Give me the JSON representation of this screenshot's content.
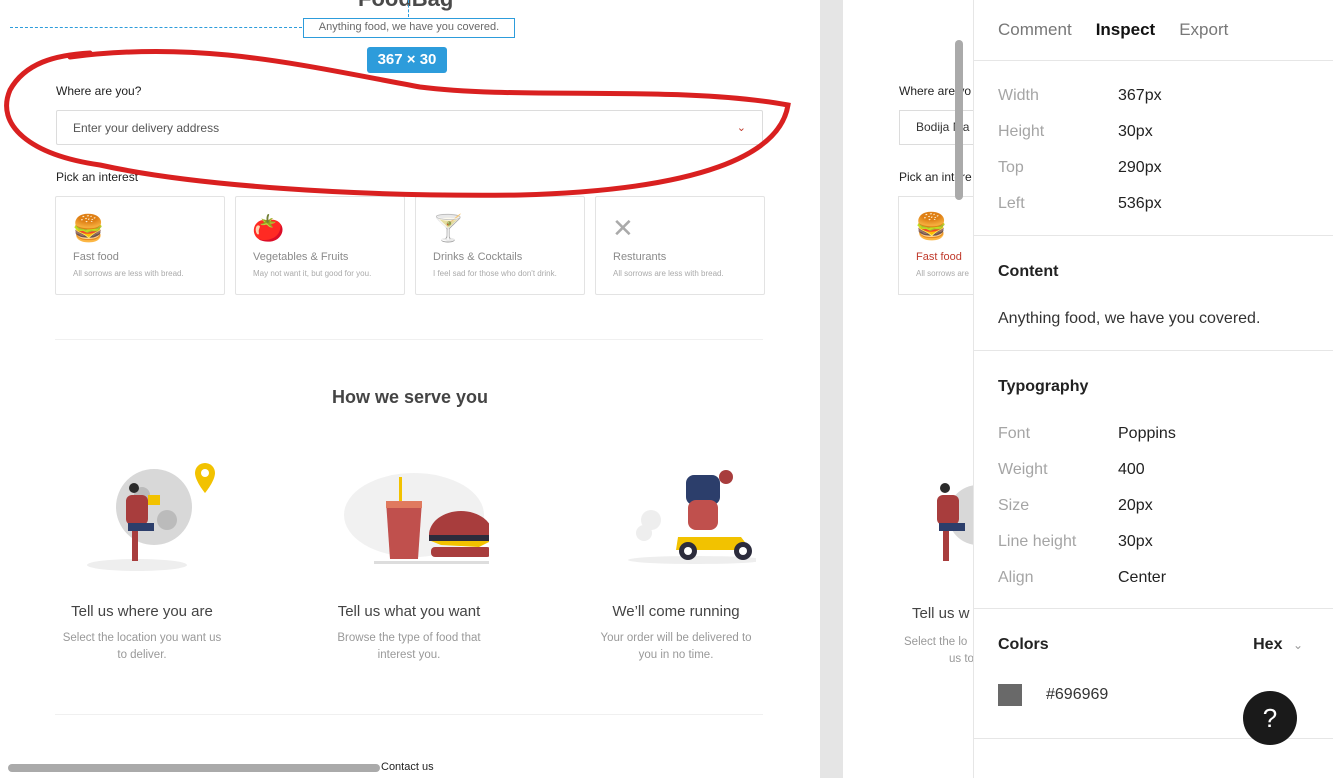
{
  "brand": "FoodBag",
  "tagline": "Anything food, we have you covered.",
  "dimension_badge": "367 × 30",
  "form": {
    "where_label": "Where are you?",
    "address_placeholder": "Enter your delivery address",
    "pick_label": "Pick an interest"
  },
  "interests": [
    {
      "title": "Fast food",
      "subtitle": "All sorrows are less with bread.",
      "icon": "fast-food-icon"
    },
    {
      "title": "Vegetables & Fruits",
      "subtitle": "May not want it, but good for you.",
      "icon": "vegetables-icon"
    },
    {
      "title": "Drinks & Cocktails",
      "subtitle": "I feel sad for those who don't drink.",
      "icon": "cocktail-icon"
    },
    {
      "title": "Resturants",
      "subtitle": "All sorrows are less with bread.",
      "icon": "cutlery-icon"
    }
  ],
  "section_title": "How we serve you",
  "steps": [
    {
      "title": "Tell us where you are",
      "desc": "Select the location you want us to deliver."
    },
    {
      "title": "Tell us what you want",
      "desc": "Browse the type of food that interest you."
    },
    {
      "title": "We’ll come running",
      "desc": "Your order will be delivered to you in no time."
    }
  ],
  "footer_link": "Contact us",
  "right_frame": {
    "where_label": "Where are yo",
    "address_value": "Bodija Ma",
    "pick_label": "Pick an intere",
    "card_title": "Fast food",
    "card_sub": "All sorrows are",
    "step_title": "Tell us w",
    "step_desc_1": "Select the lo",
    "step_desc_2": "us to"
  },
  "panel": {
    "tabs": [
      "Comment",
      "Inspect",
      "Export"
    ],
    "active_tab": "Inspect",
    "layout": [
      {
        "key": "Width",
        "value": "367px"
      },
      {
        "key": "Height",
        "value": "30px"
      },
      {
        "key": "Top",
        "value": "290px"
      },
      {
        "key": "Left",
        "value": "536px"
      }
    ],
    "content_title": "Content",
    "content_text": "Anything food, we have you covered.",
    "typography_title": "Typography",
    "typography": [
      {
        "key": "Font",
        "value": "Poppins"
      },
      {
        "key": "Weight",
        "value": "400"
      },
      {
        "key": "Size",
        "value": "20px"
      },
      {
        "key": "Line height",
        "value": "30px"
      },
      {
        "key": "Align",
        "value": "Center"
      }
    ],
    "colors_title": "Colors",
    "color_format": "Hex",
    "color_value": "#696969",
    "help": "?"
  },
  "colors": {
    "accent": "#2d9cdb",
    "annotation": "#d92020",
    "active": "#c0392b",
    "swatch": "#696969"
  }
}
